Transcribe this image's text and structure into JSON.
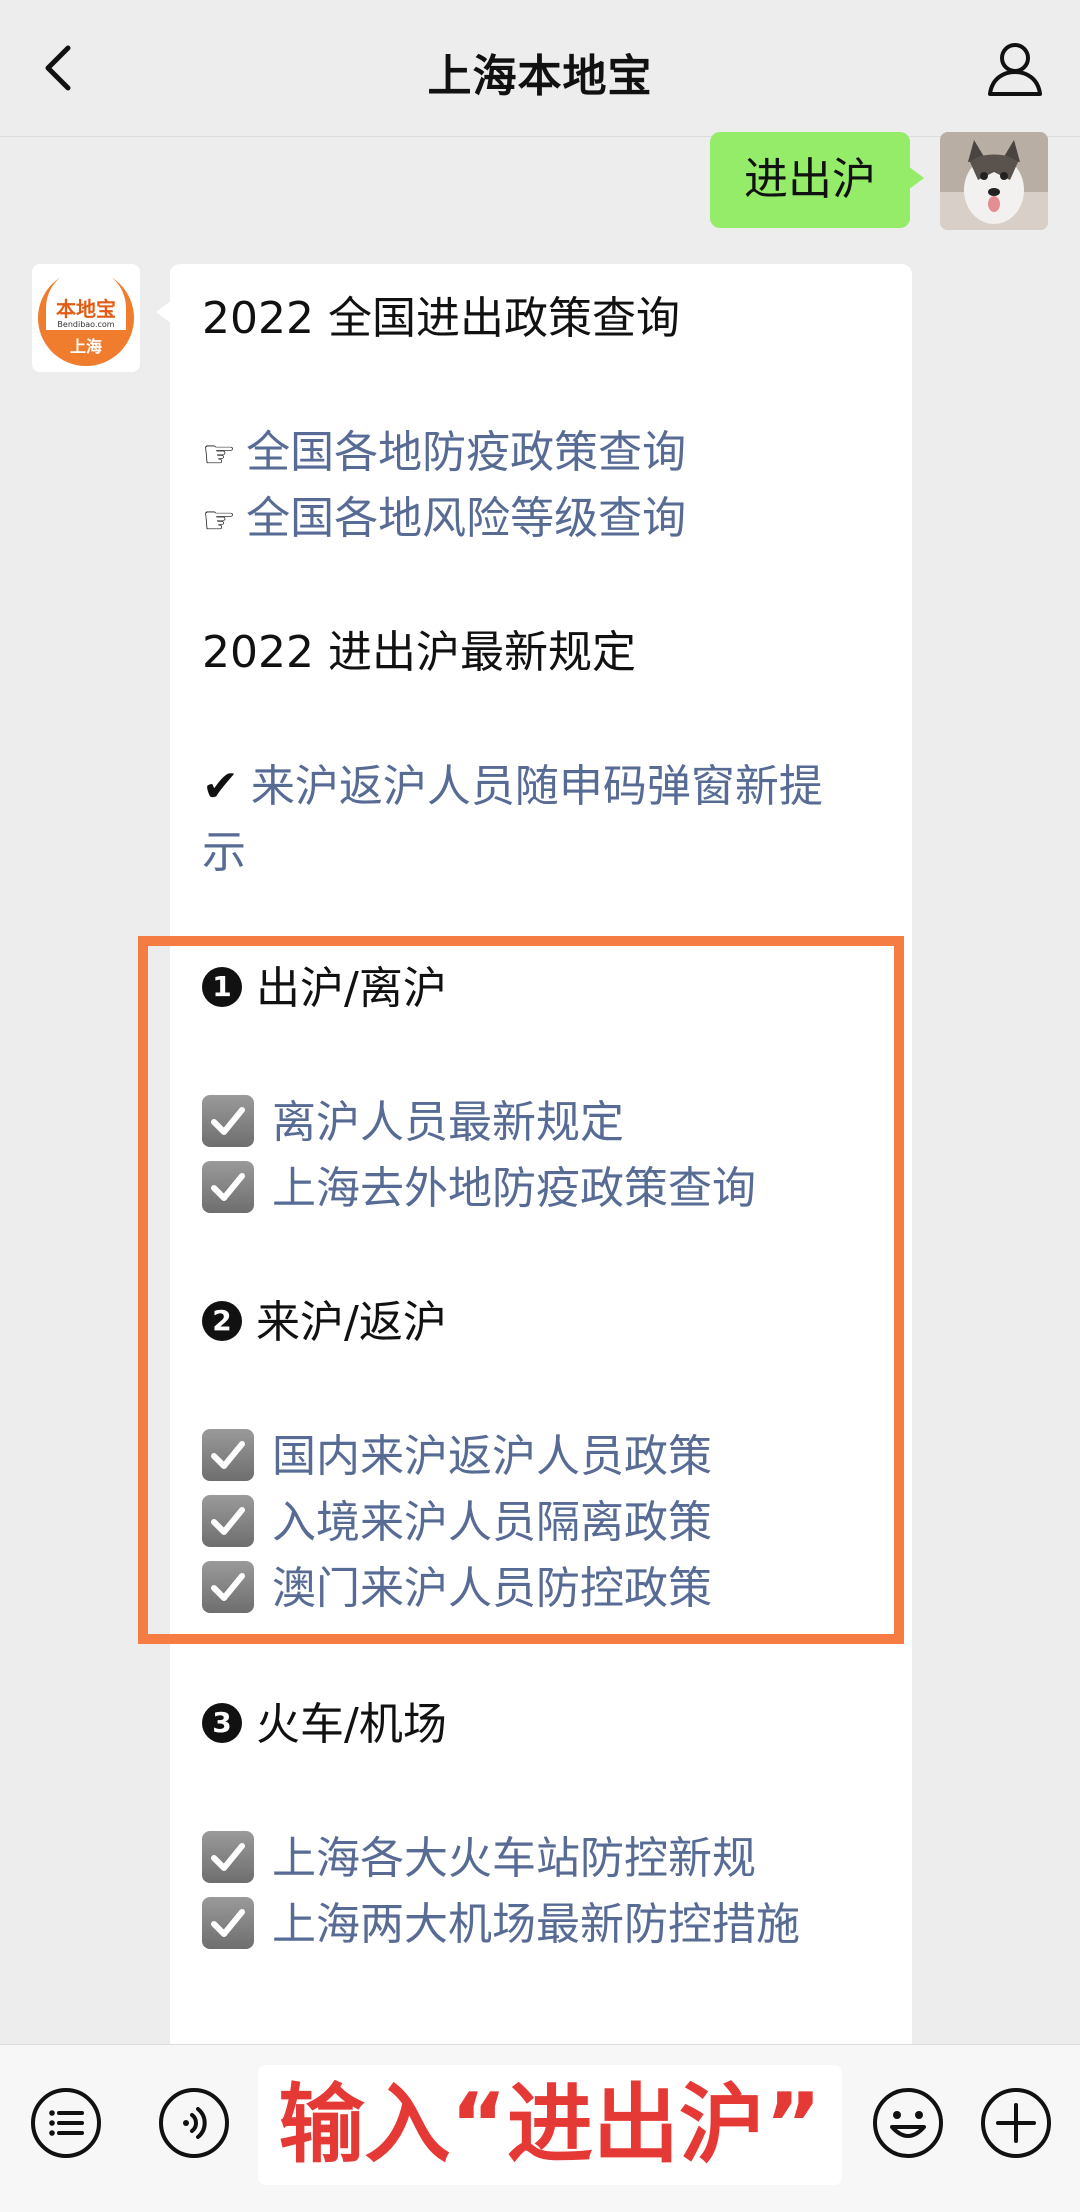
{
  "header": {
    "title": "上海本地宝"
  },
  "outgoing": {
    "text": "进出沪"
  },
  "bot": {
    "logo_top": "本地宝",
    "logo_sub": "Bendibao.com",
    "logo_city": "上海"
  },
  "message": {
    "line1": "2022 全国进出政策查询",
    "hand": "☞",
    "link1": "全国各地防疫政策查询",
    "link2": "全国各地风险等级查询",
    "line2": "2022 进出沪最新规定",
    "tick": "✔",
    "link3a": "来沪返沪人员随申码弹窗新提",
    "link3b": "示",
    "section1": {
      "num": "1",
      "title": "出沪/离沪",
      "items": [
        "离沪人员最新规定",
        "上海去外地防疫政策查询"
      ]
    },
    "section2": {
      "num": "2",
      "title": "来沪/返沪",
      "items": [
        "国内来沪返沪人员政策",
        "入境来沪人员隔离政策",
        "澳门来沪人员防控政策"
      ]
    },
    "section3": {
      "num": "3",
      "title": "火车/机场",
      "items": [
        "上海各大火车站防控新规",
        "上海两大机场最新防控措施"
      ]
    }
  },
  "input": {
    "text": "输入“进出沪”"
  },
  "colors": {
    "bubble_green": "#95ec69",
    "link": "#576b95",
    "highlight": "#f57d43",
    "input_text": "#e53935"
  },
  "icons": [
    "back-icon",
    "profile-icon",
    "menu-icon",
    "voice-icon",
    "emoji-icon",
    "plus-icon",
    "hand-point-icon",
    "check-icon"
  ]
}
